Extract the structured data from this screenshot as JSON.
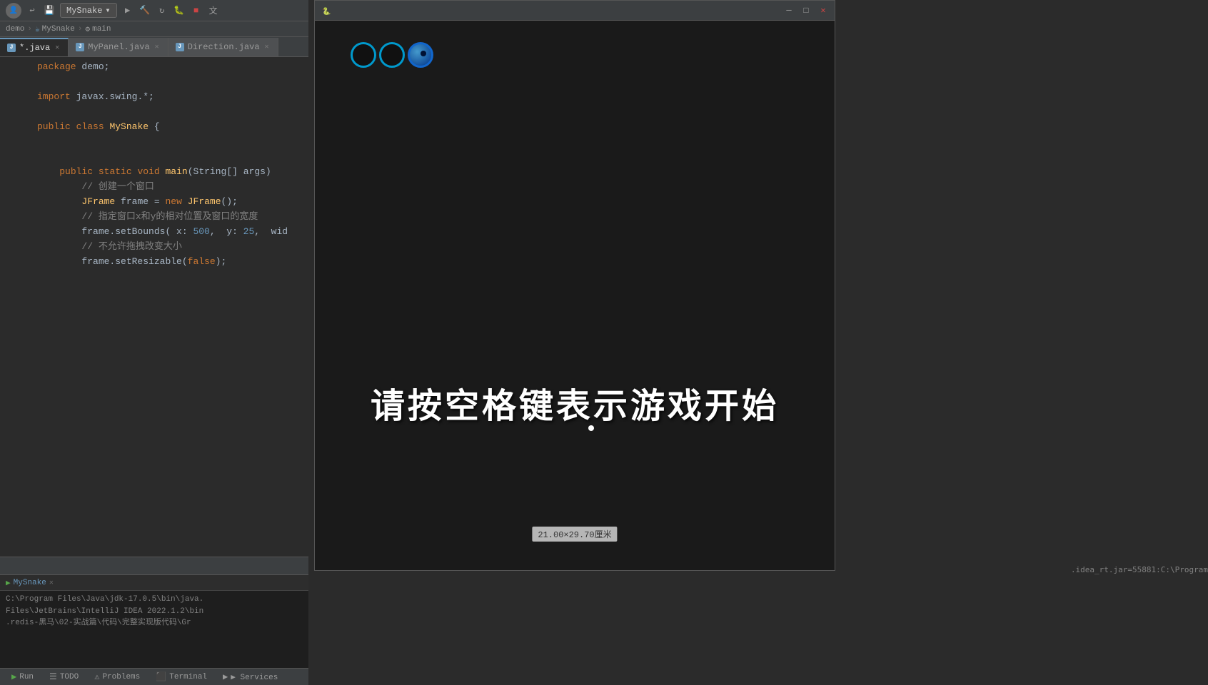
{
  "toolbar": {
    "avatar_label": "👤",
    "project_name": "MySnake",
    "dropdown_arrow": "▾",
    "branch": "main",
    "run_icons": [
      "▶",
      "🔄",
      "⏹",
      "🔧",
      "⏸",
      "文"
    ]
  },
  "breadcrumb": {
    "items": [
      "demo",
      "MySnake",
      "main"
    ]
  },
  "file_tabs": [
    {
      "name": "*.java",
      "type": "java",
      "active": true
    },
    {
      "name": "MyPanel.java",
      "type": "java",
      "active": false
    },
    {
      "name": "Direction.java",
      "type": "java",
      "active": false
    }
  ],
  "code_lines": [
    {
      "num": "",
      "content": "package demo;"
    },
    {
      "num": "",
      "content": ""
    },
    {
      "num": "",
      "content": "import javax.swing.*;"
    },
    {
      "num": "",
      "content": ""
    },
    {
      "num": "",
      "content": "public class MySnake {"
    },
    {
      "num": "",
      "content": ""
    },
    {
      "num": "",
      "content": ""
    },
    {
      "num": "",
      "content": "    public static void main(String[] args)"
    },
    {
      "num": "",
      "content": "        // 创建一个窗口"
    },
    {
      "num": "",
      "content": "        JFrame frame = new JFrame();"
    },
    {
      "num": "",
      "content": "        // 指定窗口x和y的相对位置及窗口的宽度"
    },
    {
      "num": "",
      "content": "        frame.setBounds( x: 500,  y: 25,  wid"
    },
    {
      "num": "",
      "content": "        // 不允许拖拽改变大小"
    },
    {
      "num": "",
      "content": "        frame.setResizable(false);"
    }
  ],
  "console": {
    "tab_label": "MySnake",
    "lines": [
      "C:\\Program Files\\Java\\jdk-17.0.5\\bin\\java.",
      "Files\\JetBrains\\IntelliJ IDEA 2022.1.2\\bin",
      ".redis-黑马\\02-实战篇\\代码\\完整实现版代码\\Gr"
    ],
    "suffix": ".idea_rt.jar=55881:C:\\Program"
  },
  "status_bar": {
    "buttons": [
      "▶ Run",
      "☰ TODO",
      "⚠ Problems",
      "⬛ Terminal",
      "▶ Services"
    ]
  },
  "snake_window": {
    "title": "",
    "start_text": "请按空格键表示游戏开始",
    "size_indicator": "21.00×29.70厘米",
    "snake_circles": [
      {
        "type": "outline"
      },
      {
        "type": "outline"
      },
      {
        "type": "half"
      }
    ]
  }
}
